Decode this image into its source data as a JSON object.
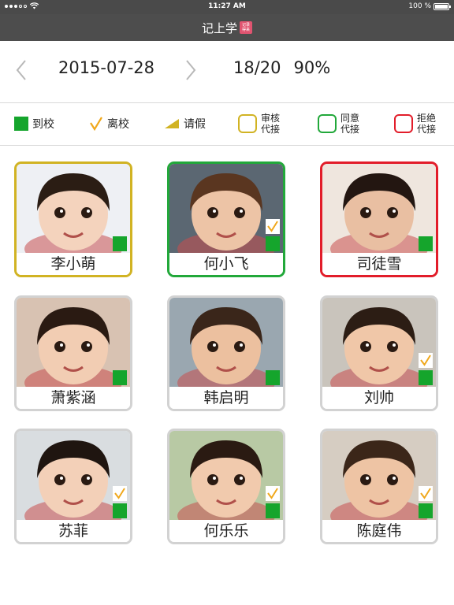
{
  "status_bar": {
    "time": "11:27 AM",
    "battery": "100 %"
  },
  "app": {
    "title": "记上学",
    "logo_text": "记录 得来"
  },
  "date_nav": {
    "date": "2015-07-28",
    "count": "18/20",
    "percent": "90%"
  },
  "legend": {
    "arrive": "到校",
    "depart": "离校",
    "leave": "请假",
    "pending": {
      "line1": "审核",
      "line2": "代接",
      "color": "#d1b323"
    },
    "approved": {
      "line1": "同意",
      "line2": "代接",
      "color": "#22a83a"
    },
    "rejected": {
      "line1": "拒绝",
      "line2": "代接",
      "color": "#e21d2a"
    }
  },
  "colors": {
    "arrive": "#15a52c",
    "depart": "#f0a81c",
    "leave": "#d1b323"
  },
  "students": [
    {
      "name": "李小萌",
      "status": "pending",
      "arrived": true,
      "departed": false
    },
    {
      "name": "何小飞",
      "status": "approved",
      "arrived": true,
      "departed": true
    },
    {
      "name": "司徒雪",
      "status": "rejected",
      "arrived": true,
      "departed": false
    },
    {
      "name": "萧紫涵",
      "status": "normal",
      "arrived": true,
      "departed": false
    },
    {
      "name": "韩启明",
      "status": "normal",
      "arrived": true,
      "departed": false
    },
    {
      "name": "刘帅",
      "status": "normal",
      "arrived": true,
      "departed": true
    },
    {
      "name": "苏菲",
      "status": "normal",
      "arrived": true,
      "departed": true
    },
    {
      "name": "何乐乐",
      "status": "normal",
      "arrived": true,
      "departed": true
    },
    {
      "name": "陈庭伟",
      "status": "normal",
      "arrived": true,
      "departed": true
    }
  ]
}
